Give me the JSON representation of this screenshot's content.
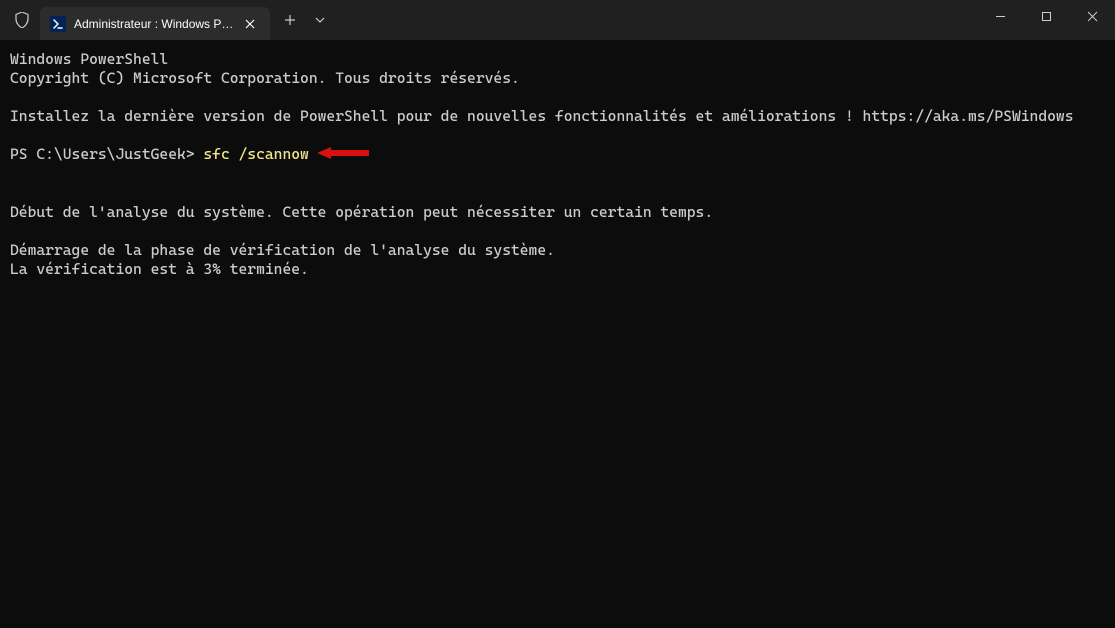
{
  "window": {
    "tab_title": "Administrateur : Windows Pow"
  },
  "terminal": {
    "line1": "Windows PowerShell",
    "line2": "Copyright (C) Microsoft Corporation. Tous droits réservés.",
    "line3": "Installez la dernière version de PowerShell pour de nouvelles fonctionnalités et améliorations ! https://aka.ms/PSWindows",
    "prompt": "PS C:\\Users\\JustGeek> ",
    "command": "sfc /scannow",
    "line_analysis": "Début de l'analyse du système. Cette opération peut nécessiter un certain temps.",
    "line_phase": "Démarrage de la phase de vérification de l'analyse du système.",
    "line_progress": "La vérification est à 3% terminée."
  },
  "colors": {
    "command_color": "#f0e68c",
    "arrow_color": "#d81010",
    "bg": "#0c0c0c",
    "titlebar": "#202020"
  }
}
